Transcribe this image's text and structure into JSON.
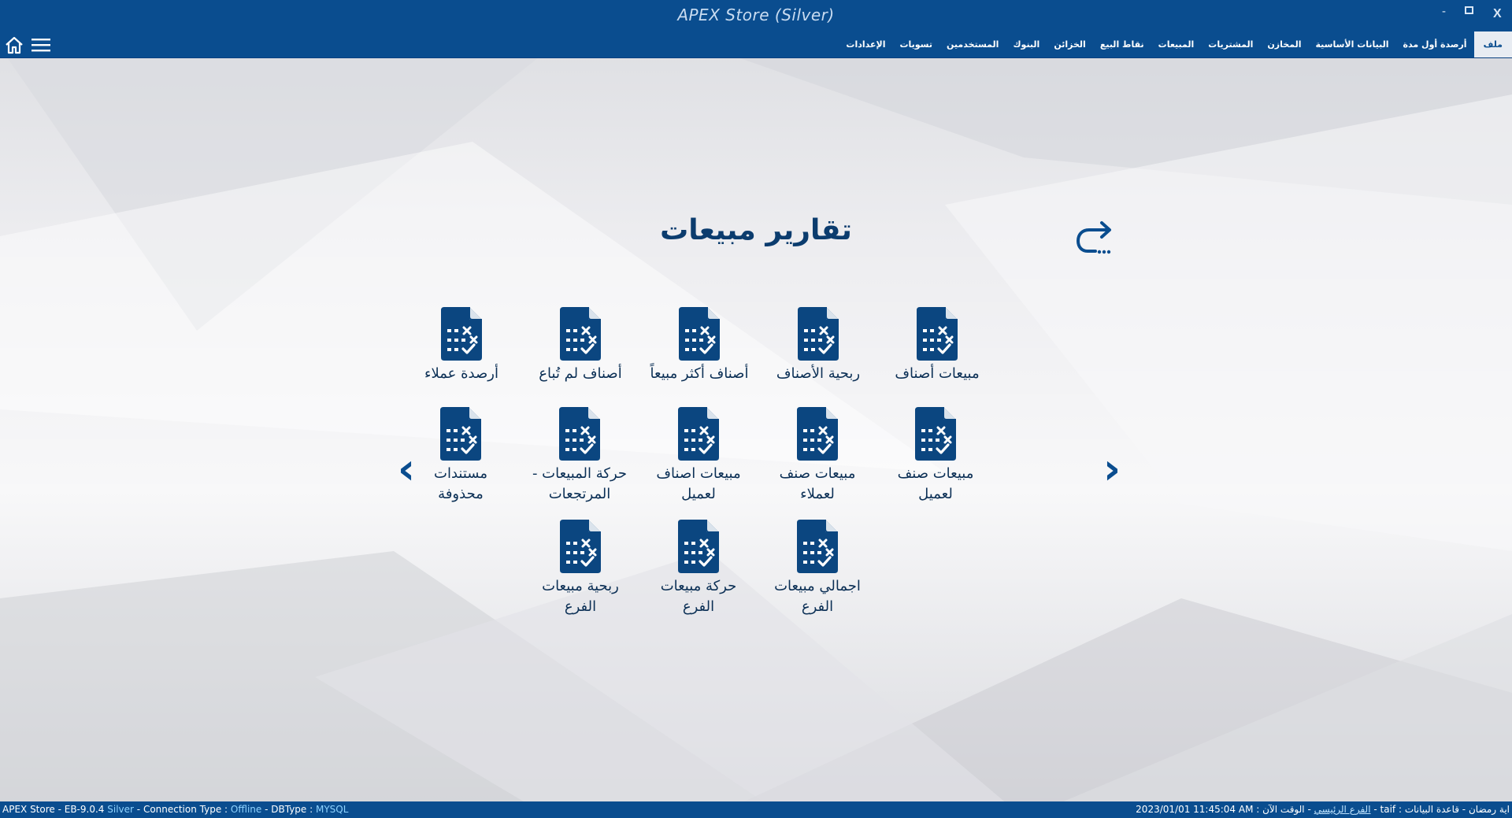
{
  "window": {
    "title": "APEX Store (Silver)",
    "minimize_label": "-",
    "close_label": "X"
  },
  "menu": {
    "items": [
      {
        "label": "ملف",
        "active": true
      },
      {
        "label": "أرصدة أول مدة"
      },
      {
        "label": "البيانات الأساسية"
      },
      {
        "label": "المخازن"
      },
      {
        "label": "المشتريات"
      },
      {
        "label": "المبيعات"
      },
      {
        "label": "نقاط البيع"
      },
      {
        "label": "الخزائن"
      },
      {
        "label": "البنوك"
      },
      {
        "label": "المستخدمين"
      },
      {
        "label": "تسويات"
      },
      {
        "label": "الإعدادات"
      }
    ]
  },
  "page": {
    "title": "تقارير مبيعات",
    "prev_arrow": "‹",
    "next_arrow": "›"
  },
  "tiles": [
    {
      "label_1": "مبيعات أصناف",
      "label_2": ""
    },
    {
      "label_1": "ربحية الأصناف",
      "label_2": ""
    },
    {
      "label_1": "أصناف أكثر مبيعاً",
      "label_2": ""
    },
    {
      "label_1": "أصناف لم تُباع",
      "label_2": ""
    },
    {
      "label_1": "أرصدة عملاء",
      "label_2": ""
    },
    {
      "label_1": "مبيعات صنف",
      "label_2": "لعميل"
    },
    {
      "label_1": "مبيعات صنف",
      "label_2": "لعملاء"
    },
    {
      "label_1": "مبيعات اصناف",
      "label_2": "لعميل"
    },
    {
      "label_1": "حركة المبيعات -",
      "label_2": "المرتجعات"
    },
    {
      "label_1": "مستندات",
      "label_2": "محذوفة"
    },
    {
      "label_1": "اجمالي مبيعات",
      "label_2": "الفرع"
    },
    {
      "label_1": "حركة مبيعات",
      "label_2": "الفرع"
    },
    {
      "label_1": "ربحية مبيعات",
      "label_2": "الفرع"
    }
  ],
  "status": {
    "product": "APEX Store - EB-9.0.4",
    "edition": "Silver",
    "connection_label": "Connection Type :",
    "connection_value": "Offline",
    "dbtype_label": "DBType :",
    "dbtype_value": "MYSQL",
    "user": "اية رمضان",
    "db_label": "قاعدة البيانات :",
    "db_value": "taif",
    "branch": "الفرع الرئيسي",
    "time_label": "الوقت الآن :",
    "time_value": "2023/01/01 11:45:04 AM"
  },
  "colors": {
    "brand_blue": "#0a4d8f",
    "icon_blue": "#0b4680",
    "title_text": "#0b3c6e"
  }
}
